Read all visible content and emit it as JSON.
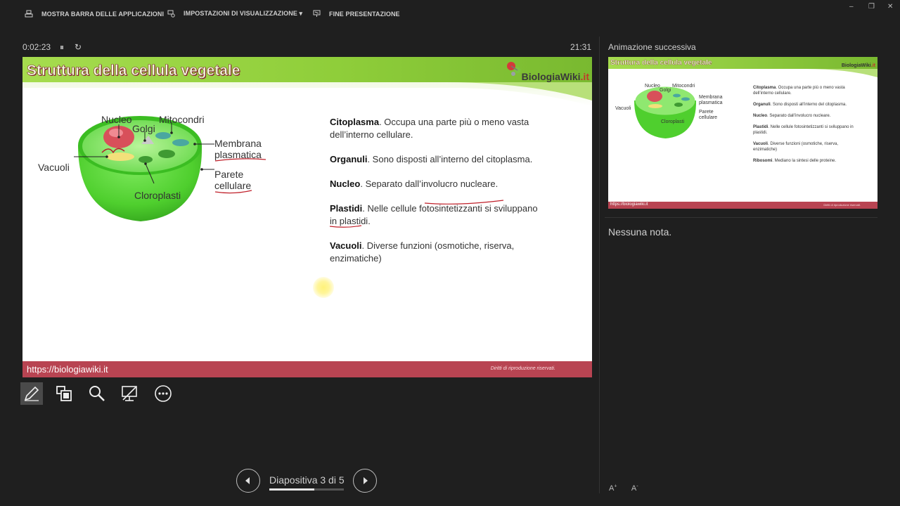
{
  "topbar": {
    "show_taskbar": "MOSTRA BARRA DELLE APPLICAZIONI",
    "display_settings": "IMPOSTAZIONI DI VISUALIZZAZIONE ▾",
    "end_show": "FINE PRESENTAZIONE"
  },
  "presenter": {
    "elapsed": "0:02:23",
    "clock": "21:31",
    "next_label": "Animazione successiva",
    "notes": "Nessuna nota.",
    "slide_counter": "Diapositiva 3 di 5",
    "current_slide": 3,
    "total_slides": 5
  },
  "slide": {
    "title": "Struttura della cellula vegetale",
    "logo_main": "BiologiaWiki",
    "logo_suffix": ".it",
    "footer_url": "https://biologiawiki.it",
    "footer_rights": "Diritti di riproduzione riservati.",
    "labels": {
      "nucleo": "Nucleo",
      "golgi": "Golgi",
      "mitocondri": "Mitocondri",
      "membrana1": "Membrana",
      "membrana2": "plasmatica",
      "vacuoli": "Vacuoli",
      "parete1": "Parete",
      "parete2": "cellulare",
      "cloroplasti": "Cloroplasti"
    },
    "bullets": [
      {
        "term": "Citoplasma",
        "text": ". Occupa una parte più o meno vasta dell’interno cellulare."
      },
      {
        "term": "Organuli",
        "text": ". Sono disposti all’interno del citoplasma."
      },
      {
        "term": "Nucleo",
        "text": ". Separato dall’involucro nucleare."
      },
      {
        "term": "Plastidi",
        "text": ". Nelle cellule fotosintetizzanti si sviluppano in plastidi."
      },
      {
        "term": "Vacuoli",
        "text": ". Diverse funzioni (osmotiche, riserva, enzimatiche)"
      }
    ]
  },
  "next_slide": {
    "title": "Struttura della cellula vegetale",
    "logo_main": "BiologiaWiki",
    "logo_suffix": ".it",
    "footer_url": "https://biologiawiki.it",
    "footer_rights": "Diritti di riproduzione riservati.",
    "bullets": [
      {
        "term": "Citoplasma",
        "text": ". Occupa una parte più o meno vasta dell’interno cellulare."
      },
      {
        "term": "Organuli",
        "text": ". Sono disposti all’interno del citoplasma."
      },
      {
        "term": "Nucleo",
        "text": ". Separato dall’involucro nucleare."
      },
      {
        "term": "Plastidi",
        "text": ". Nelle cellule fotosintetizzanti si sviluppano in plastidi."
      },
      {
        "term": "Vacuoli",
        "text": ". Diverse funzioni (osmotiche, riserva, enzimatiche)"
      },
      {
        "term": "Ribosomi",
        "text": ". Mediano la sintesi delle proteine."
      }
    ]
  },
  "colors": {
    "header_green": "#8fce3a",
    "footer_red": "#b84452",
    "cell_green": "#5fd63a"
  }
}
